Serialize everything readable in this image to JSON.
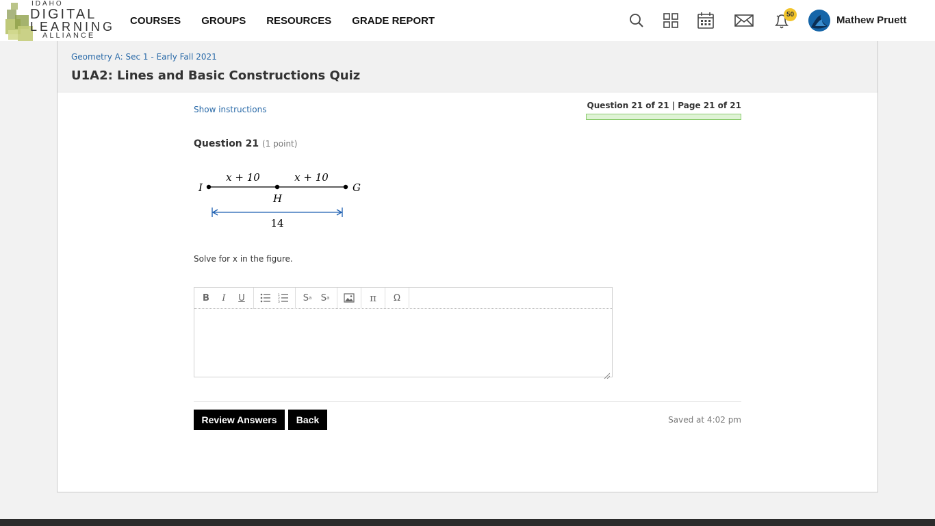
{
  "brand": {
    "line1": "IDAHO",
    "line2": "DIGITAL",
    "line3": "LEARNING",
    "line4": "ALLIANCE"
  },
  "nav": {
    "courses": "COURSES",
    "groups": "GROUPS",
    "resources": "RESOURCES",
    "grade_report": "GRADE REPORT"
  },
  "header_icons": [
    "search-icon",
    "apps-grid-icon",
    "calendar-icon",
    "mail-icon",
    "bell-icon"
  ],
  "notifications_count": "50",
  "user": {
    "name": "Mathew Pruett"
  },
  "breadcrumb": "Geometry A: Sec 1 - Early Fall 2021",
  "quiz_title": "U1A2: Lines and Basic Constructions Quiz",
  "show_instructions": "Show instructions",
  "question_counter": "Question 21 of 21 | Page 21 of 21",
  "progress_fraction": 1.0,
  "question": {
    "label": "Question 21",
    "points": "(1 point)",
    "text": "Solve for x in the figure."
  },
  "figure": {
    "point_left": "I",
    "point_mid": "H",
    "point_right": "G",
    "seg_left": "x + 10",
    "seg_right": "x + 10",
    "total": "14"
  },
  "editor_tools": [
    "bold-icon",
    "italic-icon",
    "underline-icon",
    "bullet-list-icon",
    "numbered-list-icon",
    "superscript-icon",
    "subscript-icon",
    "image-icon",
    "pi-icon",
    "omega-icon"
  ],
  "buttons": {
    "review": "Review Answers",
    "back": "Back"
  },
  "saved_text": "Saved at 4:02 pm",
  "colors": {
    "link": "#2a6aa8",
    "progress_fill": "#dff3d5",
    "progress_border": "#8ccc6f",
    "badge": "#f2c42a",
    "arrow": "#1a5db0"
  }
}
